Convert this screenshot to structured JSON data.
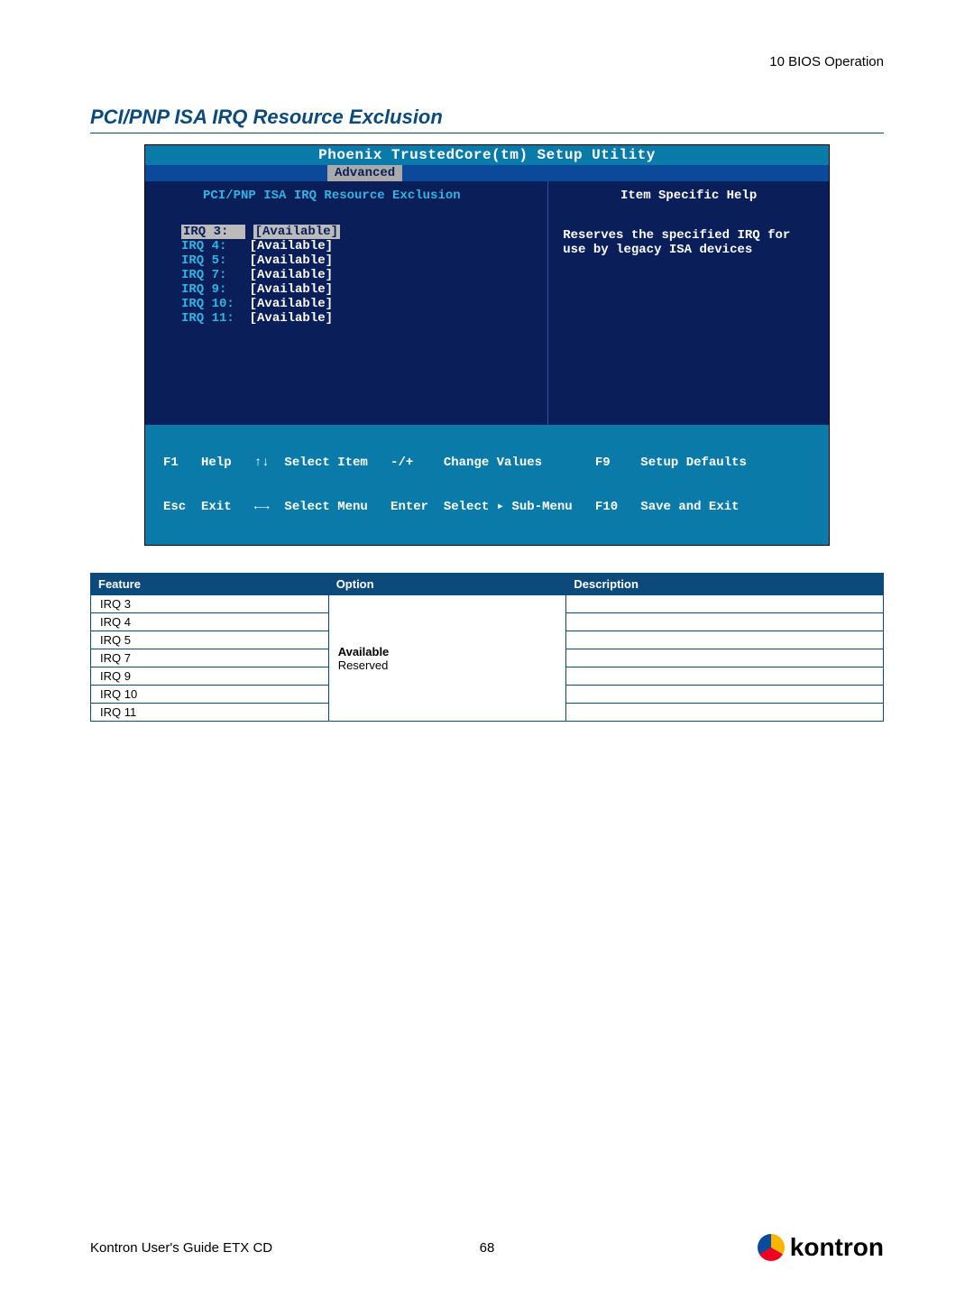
{
  "chapter_header": "10 BIOS Operation",
  "section_title": "PCI/PNP ISA IRQ Resource Exclusion",
  "bios": {
    "title": "Phoenix TrustedCore(tm) Setup Utility",
    "tab": "Advanced",
    "subtitle": "PCI/PNP ISA IRQ Resource Exclusion",
    "right_title": "Item Specific Help",
    "help_text": "Reserves the specified IRQ for use by legacy ISA devices",
    "items": [
      {
        "label": "IRQ 3:",
        "value": "[Available]",
        "highlighted": true
      },
      {
        "label": "IRQ 4:",
        "value": "[Available]",
        "highlighted": false
      },
      {
        "label": "IRQ 5:",
        "value": "[Available]",
        "highlighted": false
      },
      {
        "label": "IRQ 7:",
        "value": "[Available]",
        "highlighted": false
      },
      {
        "label": "IRQ 9:",
        "value": "[Available]",
        "highlighted": false
      },
      {
        "label": "IRQ 10:",
        "value": "[Available]",
        "highlighted": false
      },
      {
        "label": "IRQ 11:",
        "value": "[Available]",
        "highlighted": false
      }
    ],
    "footer_line1": "F1   Help   ↑↓  Select Item   -/+    Change Values       F9    Setup Defaults",
    "footer_line2": "Esc  Exit   ←→  Select Menu   Enter  Select ▸ Sub-Menu   F10   Save and Exit"
  },
  "table": {
    "headers": {
      "feature": "Feature",
      "option": "Option",
      "description": "Description"
    },
    "option_bold": "Available",
    "option_plain": "Reserved",
    "rows": [
      {
        "feature": "IRQ 3",
        "description": ""
      },
      {
        "feature": "IRQ 4",
        "description": ""
      },
      {
        "feature": "IRQ 5",
        "description": ""
      },
      {
        "feature": "IRQ 7",
        "description": ""
      },
      {
        "feature": "IRQ 9",
        "description": ""
      },
      {
        "feature": "IRQ 10",
        "description": ""
      },
      {
        "feature": "IRQ 11",
        "description": ""
      }
    ]
  },
  "footer": {
    "left": "Kontron User's Guide ETX CD",
    "page": "68",
    "logo_text": "kontron"
  }
}
